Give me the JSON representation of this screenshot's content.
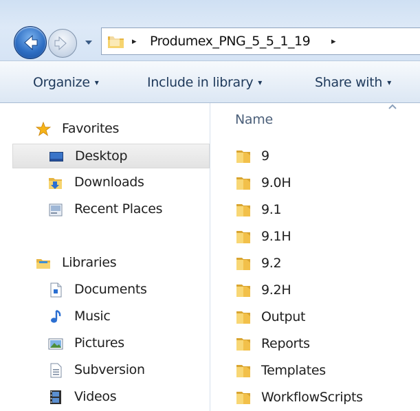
{
  "address_bar": {
    "path_segment": "Produmex_PNG_5_5_1_19",
    "separator": "▸"
  },
  "toolbar": {
    "organize_label": "Organize",
    "include_label": "Include in library",
    "share_label": "Share with",
    "caret": "▾"
  },
  "nav": {
    "favorites": {
      "label": "Favorites",
      "items": [
        {
          "label": "Desktop",
          "icon": "desktop-icon",
          "selected": true
        },
        {
          "label": "Downloads",
          "icon": "downloads-icon"
        },
        {
          "label": "Recent Places",
          "icon": "recent-places-icon"
        }
      ]
    },
    "libraries": {
      "label": "Libraries",
      "items": [
        {
          "label": "Documents",
          "icon": "documents-icon"
        },
        {
          "label": "Music",
          "icon": "music-icon"
        },
        {
          "label": "Pictures",
          "icon": "pictures-icon"
        },
        {
          "label": "Subversion",
          "icon": "subversion-icon"
        },
        {
          "label": "Videos",
          "icon": "videos-icon"
        }
      ]
    }
  },
  "content": {
    "column_header": "Name",
    "files": [
      {
        "name": "9"
      },
      {
        "name": "9.0H"
      },
      {
        "name": "9.1"
      },
      {
        "name": "9.1H"
      },
      {
        "name": "9.2"
      },
      {
        "name": "9.2H"
      },
      {
        "name": "Output"
      },
      {
        "name": "Reports"
      },
      {
        "name": "Templates"
      },
      {
        "name": "WorkflowScripts"
      }
    ]
  },
  "colors": {
    "selected_bg": "#e8e8e8",
    "folder_yellow": "#f2c04a",
    "command_text": "#1e395b"
  }
}
